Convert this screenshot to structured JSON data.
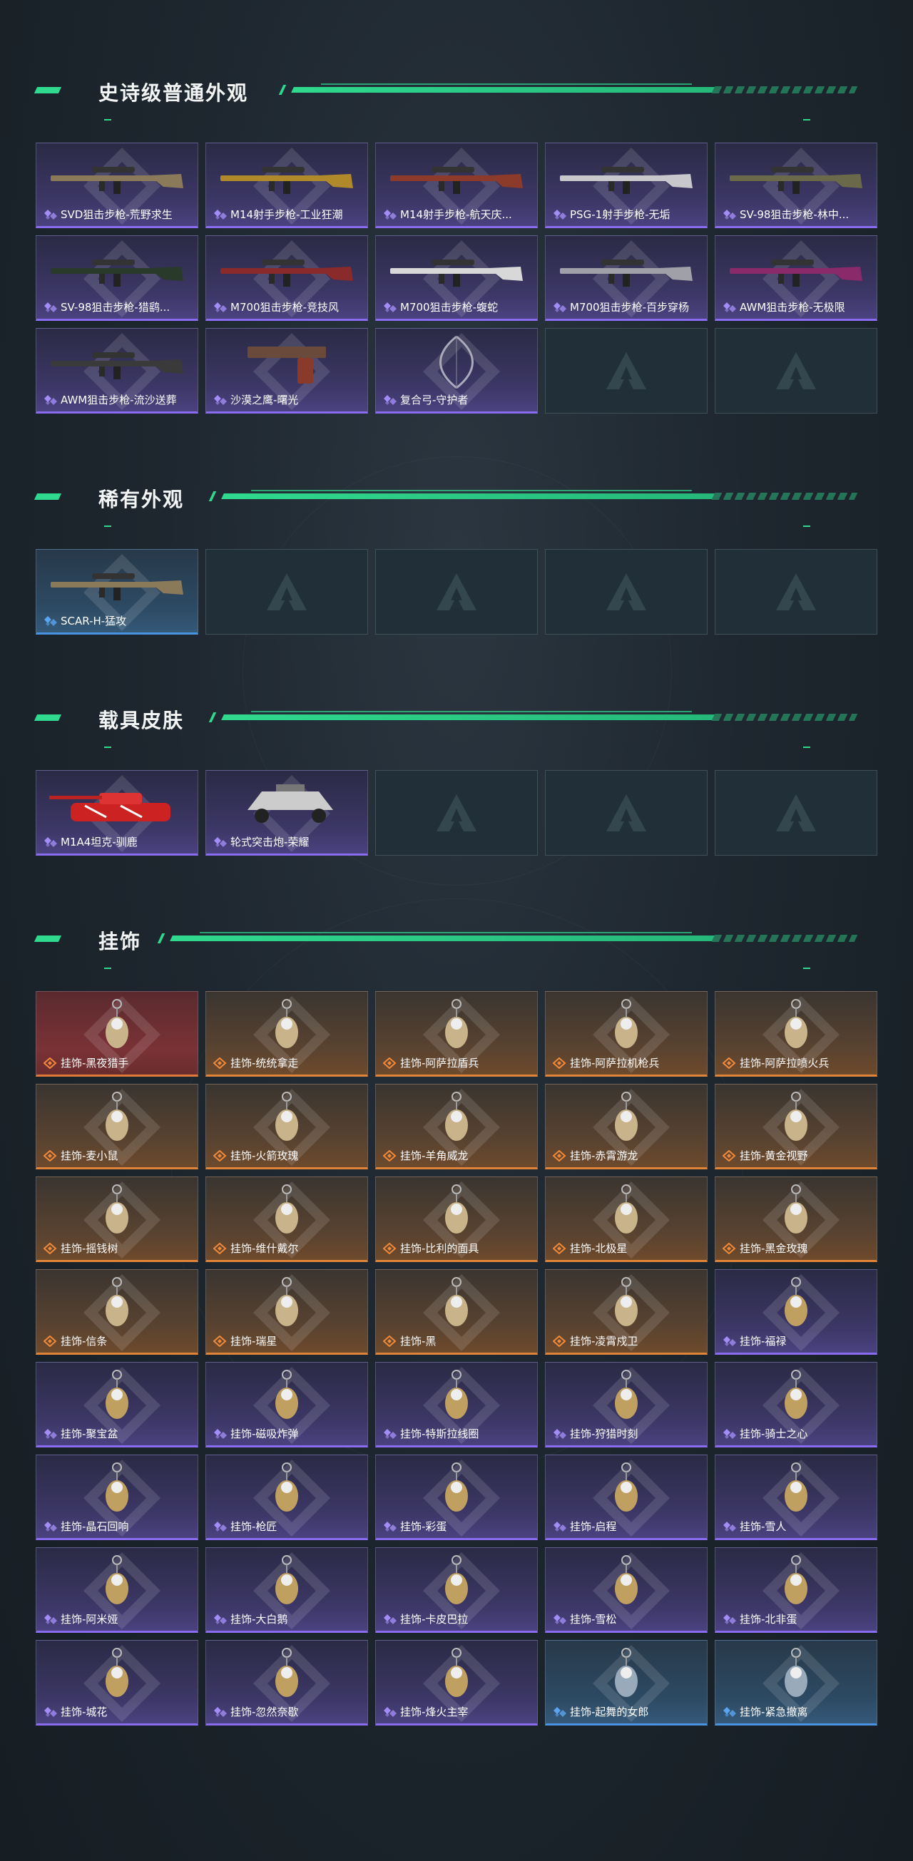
{
  "sections": [
    {
      "title": "史诗级普通外观",
      "items": [
        {
          "label": "SVD狙击步枪-荒野求生",
          "rarity": "purple",
          "icon": "rifle-icon"
        },
        {
          "label": "M14射手步枪-工业狂潮",
          "rarity": "purple",
          "icon": "rifle-icon"
        },
        {
          "label": "M14射手步枪-航天庆...",
          "rarity": "purple",
          "icon": "rifle-icon"
        },
        {
          "label": "PSG-1射手步枪-无垢",
          "rarity": "purple",
          "icon": "rifle-icon"
        },
        {
          "label": "SV-98狙击步枪-林中...",
          "rarity": "purple",
          "icon": "rifle-icon"
        },
        {
          "label": "SV-98狙击步枪-猎鹞...",
          "rarity": "purple",
          "icon": "rifle-icon"
        },
        {
          "label": "M700狙击步枪-竞技风",
          "rarity": "purple",
          "icon": "rifle-icon"
        },
        {
          "label": "M700狙击步枪-蝮蛇",
          "rarity": "purple",
          "icon": "rifle-icon"
        },
        {
          "label": "M700狙击步枪-百步穿杨",
          "rarity": "purple",
          "icon": "rifle-icon"
        },
        {
          "label": "AWM狙击步枪-无极限",
          "rarity": "purple",
          "icon": "rifle-icon"
        },
        {
          "label": "AWM狙击步枪-流沙送葬",
          "rarity": "purple",
          "icon": "rifle-icon"
        },
        {
          "label": "沙漠之鹰-曙光",
          "rarity": "purple",
          "icon": "pistol-icon"
        },
        {
          "label": "复合弓-守护者",
          "rarity": "purple",
          "icon": "bow-icon"
        },
        {
          "label": "",
          "rarity": "empty"
        },
        {
          "label": "",
          "rarity": "empty"
        }
      ]
    },
    {
      "title": "稀有外观",
      "items": [
        {
          "label": "SCAR-H-猛攻",
          "rarity": "blue",
          "icon": "rifle-icon"
        },
        {
          "label": "",
          "rarity": "empty"
        },
        {
          "label": "",
          "rarity": "empty"
        },
        {
          "label": "",
          "rarity": "empty"
        },
        {
          "label": "",
          "rarity": "empty"
        }
      ]
    },
    {
      "title": "载具皮肤",
      "items": [
        {
          "label": "M1A4坦克-驯鹿",
          "rarity": "purple",
          "icon": "tank-icon"
        },
        {
          "label": "轮式突击炮-荣耀",
          "rarity": "purple",
          "icon": "armored-car-icon"
        },
        {
          "label": "",
          "rarity": "empty"
        },
        {
          "label": "",
          "rarity": "empty"
        },
        {
          "label": "",
          "rarity": "empty"
        }
      ]
    },
    {
      "title": "挂饰",
      "items": [
        {
          "label": "挂饰-黑夜猎手",
          "rarity": "red",
          "icon": "charm-icon"
        },
        {
          "label": "挂饰-统统拿走",
          "rarity": "orange",
          "icon": "charm-icon"
        },
        {
          "label": "挂饰-阿萨拉盾兵",
          "rarity": "orange",
          "icon": "charm-icon"
        },
        {
          "label": "挂饰-阿萨拉机枪兵",
          "rarity": "orange",
          "icon": "charm-icon"
        },
        {
          "label": "挂饰-阿萨拉喷火兵",
          "rarity": "orange",
          "icon": "charm-icon"
        },
        {
          "label": "挂饰-麦小鼠",
          "rarity": "orange",
          "icon": "charm-icon"
        },
        {
          "label": "挂饰-火箭玫瑰",
          "rarity": "orange",
          "icon": "charm-icon"
        },
        {
          "label": "挂饰-羊角威龙",
          "rarity": "orange",
          "icon": "charm-icon"
        },
        {
          "label": "挂饰-赤霄游龙",
          "rarity": "orange",
          "icon": "charm-icon"
        },
        {
          "label": "挂饰-黄金视野",
          "rarity": "orange",
          "icon": "charm-icon"
        },
        {
          "label": "挂饰-摇钱树",
          "rarity": "orange",
          "icon": "charm-icon"
        },
        {
          "label": "挂饰-维什戴尔",
          "rarity": "orange",
          "icon": "charm-icon"
        },
        {
          "label": "挂饰-比利的面具",
          "rarity": "orange",
          "icon": "charm-icon"
        },
        {
          "label": "挂饰-北极星",
          "rarity": "orange",
          "icon": "charm-icon"
        },
        {
          "label": "挂饰-黑金玫瑰",
          "rarity": "orange",
          "icon": "charm-icon"
        },
        {
          "label": "挂饰-信条",
          "rarity": "orange",
          "icon": "charm-icon"
        },
        {
          "label": "挂饰-瑞星",
          "rarity": "orange",
          "icon": "charm-icon"
        },
        {
          "label": "挂饰-黑",
          "rarity": "orange",
          "icon": "charm-icon"
        },
        {
          "label": "挂饰-凌霄戍卫",
          "rarity": "orange",
          "icon": "charm-icon"
        },
        {
          "label": "挂饰-福禄",
          "rarity": "purple",
          "icon": "charm-icon"
        },
        {
          "label": "挂饰-聚宝盆",
          "rarity": "purple",
          "icon": "charm-icon"
        },
        {
          "label": "挂饰-磁吸炸弹",
          "rarity": "purple",
          "icon": "charm-icon"
        },
        {
          "label": "挂饰-特斯拉线圈",
          "rarity": "purple",
          "icon": "charm-icon"
        },
        {
          "label": "挂饰-狩猎时刻",
          "rarity": "purple",
          "icon": "charm-icon"
        },
        {
          "label": "挂饰-骑士之心",
          "rarity": "purple",
          "icon": "charm-icon"
        },
        {
          "label": "挂饰-晶石回响",
          "rarity": "purple",
          "icon": "charm-icon"
        },
        {
          "label": "挂饰-枪匠",
          "rarity": "purple",
          "icon": "charm-icon"
        },
        {
          "label": "挂饰-彩蛋",
          "rarity": "purple",
          "icon": "charm-icon"
        },
        {
          "label": "挂饰-启程",
          "rarity": "purple",
          "icon": "charm-icon"
        },
        {
          "label": "挂饰-雪人",
          "rarity": "purple",
          "icon": "charm-icon"
        },
        {
          "label": "挂饰-阿米娅",
          "rarity": "purple",
          "icon": "charm-icon"
        },
        {
          "label": "挂饰-大白鹅",
          "rarity": "purple",
          "icon": "charm-icon"
        },
        {
          "label": "挂饰-卡皮巴拉",
          "rarity": "purple",
          "icon": "charm-icon"
        },
        {
          "label": "挂饰-雪松",
          "rarity": "purple",
          "icon": "charm-icon"
        },
        {
          "label": "挂饰-北非蛋",
          "rarity": "purple",
          "icon": "charm-icon"
        },
        {
          "label": "挂饰-城花",
          "rarity": "purple",
          "icon": "charm-icon"
        },
        {
          "label": "挂饰-忽然奈歇",
          "rarity": "purple",
          "icon": "charm-icon"
        },
        {
          "label": "挂饰-烽火主宰",
          "rarity": "purple",
          "icon": "charm-icon"
        },
        {
          "label": "挂饰-起舞的女郎",
          "rarity": "blue",
          "icon": "charm-icon"
        },
        {
          "label": "挂饰-紧急撤离",
          "rarity": "blue",
          "icon": "charm-icon"
        }
      ]
    }
  ],
  "colors": {
    "accent": "#2fd98e",
    "purple": "#8a6cf0",
    "blue": "#4a93e0",
    "orange": "#e0843a"
  }
}
